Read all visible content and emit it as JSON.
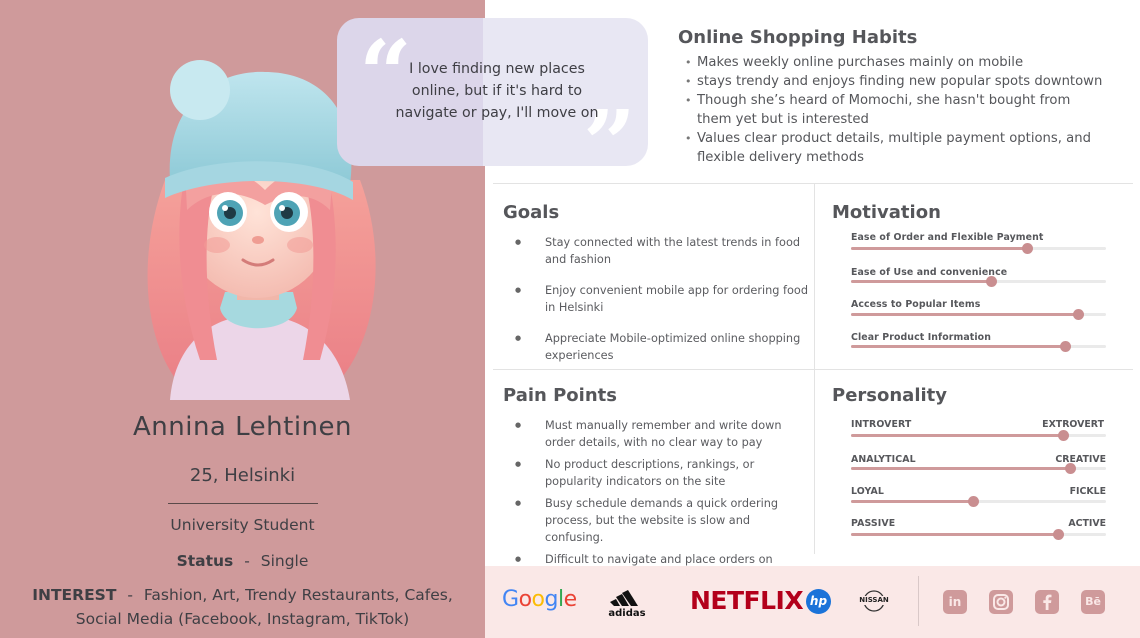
{
  "quote": {
    "text": "I love finding new places online, but if it's hard to navigate or pay, I'll move on"
  },
  "profile": {
    "name": "Annina Lehtinen",
    "age_location": "25, Helsinki",
    "occupation": "University Student",
    "status_label": "Status",
    "status_sep": "-",
    "status_value": "Single",
    "interest_label": "INTEREST",
    "interest_sep": "-",
    "interest_value": "Fashion, Art, Trendy Restaurants, Cafes, Social Media (Facebook, Instagram, TikTok)"
  },
  "habits": {
    "title": "Online Shopping Habits",
    "items": [
      "Makes weekly online purchases mainly on mobile",
      "stays trendy and enjoys finding new popular spots downtown",
      "Though she’s heard of Momochi, she hasn't bought from them yet but is interested",
      "Values clear product details, multiple payment options, and flexible delivery methods"
    ]
  },
  "goals": {
    "title": "Goals",
    "items": [
      "Stay connected with the latest trends in food and fashion",
      "Enjoy convenient mobile app for ordering food in Helsinki",
      "Appreciate Mobile-optimized online shopping experiences"
    ]
  },
  "pain_points": {
    "title": "Pain Points",
    "items": [
      "Must manually remember and write down order details, with no clear way to pay",
      "No product descriptions, rankings, or popularity indicators on the site",
      "Busy schedule demands a quick ordering process, but the website is slow and confusing.",
      "Difficult to navigate and place orders on mobile"
    ]
  },
  "motivation": {
    "title": "Motivation",
    "bars": [
      {
        "label": "Ease of Order and Flexible Payment",
        "value": 0.69
      },
      {
        "label": "Ease of Use and convenience",
        "value": 0.55
      },
      {
        "label": "Access to Popular Items",
        "value": 0.89
      },
      {
        "label": "Clear Product Information",
        "value": 0.84
      }
    ]
  },
  "personality": {
    "title": "Personality",
    "bars": [
      {
        "left": "INTROVERT",
        "right": "EXTROVERT",
        "value": 0.83
      },
      {
        "left": "ANALYTICAL",
        "right": "CREATIVE",
        "value": 0.86
      },
      {
        "left": "LOYAL",
        "right": "FICKLE",
        "value": 0.48
      },
      {
        "left": "PASSIVE",
        "right": "ACTIVE",
        "value": 0.81
      }
    ]
  },
  "brands": {
    "google": "Google",
    "adidas": "adidas",
    "netflix": "NETFLIX",
    "hp": "hp",
    "nissan": "NISSAN"
  },
  "social": {
    "linkedin": "in",
    "behance": "Bē"
  },
  "colors": {
    "accent": "#cf9a9b",
    "footer": "#fae8e7",
    "netflix": "#b3001b",
    "hp": "#1a73d9"
  }
}
